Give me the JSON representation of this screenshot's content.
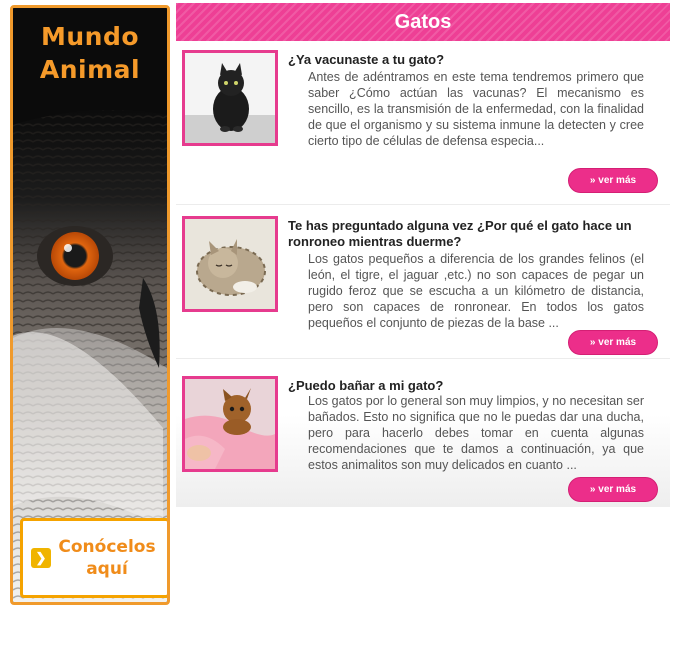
{
  "banner": {
    "title_line1": "Mundo",
    "title_line2": "Animal",
    "cta_line1": "Conócelos",
    "cta_line2": "aquí",
    "cta_icon": "chevron-right-icon"
  },
  "section": {
    "title": "Gatos"
  },
  "articles": [
    {
      "title": "¿Ya vacunaste a tu gato?",
      "text": "Antes de adéntramos en este tema tendremos primero que saber ¿Cómo actúan las vacunas? El mecanismo es sencillo, es la transmisión de la enfermedad, con la finalidad de que el organismo y su sistema inmune la detecten y cree cierto tipo de células de defensa especia...",
      "more_label": "» ver más"
    },
    {
      "title": "Te has preguntado alguna vez ¿Por qué el gato hace un ronroneo mientras duerme?",
      "text": "Los gatos pequeños a diferencia de los grandes felinos (el león, el tigre, el jaguar ,etc.) no son capaces de pegar un rugido feroz que se escucha a un kilómetro de distancia, pero son capaces de ronronear. En todos los gatos pequeños el conjunto de piezas de la base ...",
      "more_label": "» ver más"
    },
    {
      "title": "¿Puedo bañar a mi gato?",
      "text": "Los gatos por lo general son muy limpios, y no necesitan ser bañados. Esto no significa que no le puedas dar una ducha, pero para hacerlo debes tomar en cuenta algunas recomendaciones que te damos a continuación, ya que estos animalitos son muy delicados en cuanto ...",
      "more_label": "» ver más"
    }
  ],
  "colors": {
    "accent_pink": "#ee3f95",
    "accent_orange": "#f59a2a"
  }
}
